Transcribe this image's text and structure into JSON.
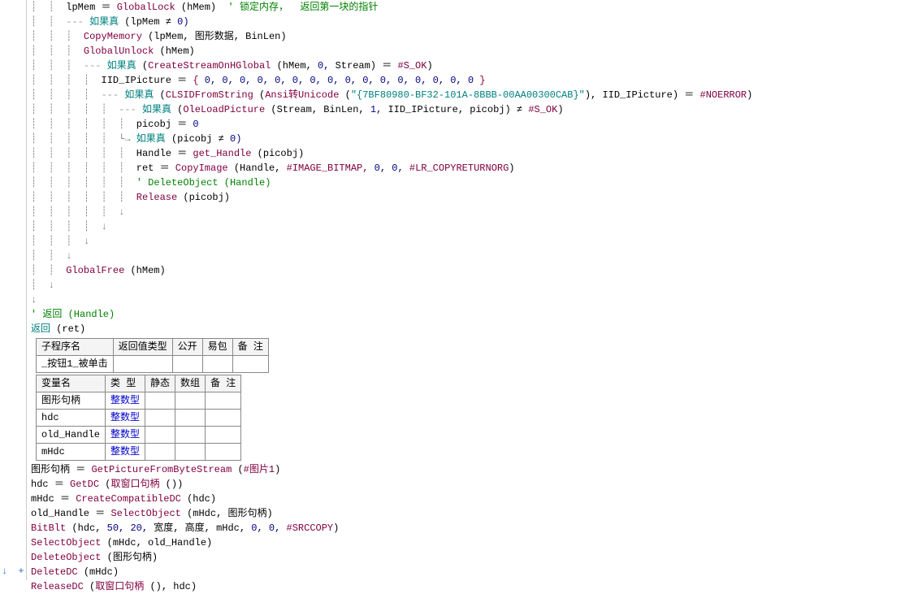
{
  "code": {
    "l1": {
      "a": "lpMem",
      "b": "＝",
      "c": "GlobalLock",
      "d": "(hMem)",
      "cmt": "' 锁定内存，  返回第一块的指针"
    },
    "l2": {
      "a": "如果真",
      "b": "(lpMem",
      "c": "≠",
      "d": "0)"
    },
    "l3": {
      "a": "CopyMemory",
      "b": "(lpMem,",
      "c": "图形数据,",
      "d": "BinLen)"
    },
    "l4": {
      "a": "GlobalUnlock",
      "b": "(hMem)"
    },
    "l5": {
      "a": "如果真",
      "b": "(",
      "c": "CreateStreamOnHGlobal",
      "d": "(hMem,",
      "e": "0,",
      "f": "Stream)",
      "g": "＝",
      "h": "#S_OK",
      "i": ")"
    },
    "l6": {
      "a": "IID_IPicture",
      "b": "＝",
      "c": "{",
      "d": "0, 0, 0, 0, 0, 0, 0, 0, 0, 0, 0, 0, 0, 0, 0, 0",
      "e": "}"
    },
    "l7": {
      "a": "如果真",
      "b": "(",
      "c": "CLSIDFromString",
      "d": "(",
      "e": "Ansi转Unicode",
      "f": "(",
      "g": "\"{7BF80980-BF32-101A-8BBB-00AA00300CAB}\"",
      "h": "),",
      "i": "IID_IPicture)",
      "j": "＝",
      "k": "#NOERROR",
      "l": ")"
    },
    "l8": {
      "a": "如果真",
      "b": "(",
      "c": "OleLoadPicture",
      "d": "(Stream,",
      "e": "BinLen,",
      "f": "1,",
      "g": "IID_IPicture,",
      "h": "picobj)",
      "i": "≠",
      "j": "#S_OK",
      "k": ")"
    },
    "l9": {
      "a": "picobj",
      "b": "＝",
      "c": "0"
    },
    "l10": {
      "a": "如果真",
      "b": "(picobj",
      "c": "≠",
      "d": "0)"
    },
    "l11": {
      "a": "Handle",
      "b": "＝",
      "c": "get_Handle",
      "d": "(picobj)"
    },
    "l12": {
      "a": "ret",
      "b": "＝",
      "c": "CopyImage",
      "d": "(Handle,",
      "e": "#IMAGE_BITMAP,",
      "f": "0,",
      "g": "0,",
      "h": "#LR_COPYRETURNORG",
      ")": ")"
    },
    "l13": {
      "cmt": "' DeleteObject (Handle)"
    },
    "l14": {
      "a": "Release",
      "b": "(picobj)"
    },
    "l15": {
      "a": "GlobalFree",
      "b": "(hMem)"
    },
    "l16": {
      "cmt": "' 返回 (Handle)"
    },
    "l17": {
      "a": "返回",
      "b": "(ret)"
    }
  },
  "table1": {
    "headers": [
      "子程序名",
      "返回值类型",
      "公开",
      "易包",
      "备 注"
    ],
    "row": [
      "_按钮1_被单击",
      "",
      "",
      "",
      ""
    ]
  },
  "table2": {
    "headers": [
      "变量名",
      "类 型",
      "静态",
      "数组",
      "备 注"
    ],
    "rows": [
      [
        "图形句柄",
        "整数型",
        "",
        "",
        ""
      ],
      [
        "hdc",
        "整数型",
        "",
        "",
        ""
      ],
      [
        "old_Handle",
        "整数型",
        "",
        "",
        ""
      ],
      [
        "mHdc",
        "整数型",
        "",
        "",
        ""
      ]
    ]
  },
  "code2": {
    "l1": {
      "a": "图形句柄",
      "b": "＝",
      "c": "GetPictureFromByteStream",
      "d": "(",
      "e": "#图片1",
      "f": ")"
    },
    "l2": {
      "a": "hdc",
      "b": "＝",
      "c": "GetDC",
      "d": "(",
      "e": "取窗口句柄",
      "f": "())"
    },
    "l3": {
      "a": "mHdc",
      "b": "＝",
      "c": "CreateCompatibleDC",
      "d": "(hdc)"
    },
    "l4": {
      "a": "old_Handle",
      "b": "＝",
      "c": "SelectObject",
      "d": "(mHdc,",
      "e": "图形句柄)"
    },
    "l5": {
      "a": "BitBlt",
      "b": "(hdc,",
      "c": "50,",
      "d": "20,",
      "e": "宽度,",
      "f": "高度,",
      "g": "mHdc,",
      "h": "0,",
      "i": "0,",
      "j": "#SRCCOPY",
      ")": ")"
    },
    "l6": {
      "a": "SelectObject",
      "b": "(mHdc,",
      "c": "old_Handle)"
    },
    "l7": {
      "a": "DeleteObject",
      "b": "(图形句柄)"
    },
    "l8": {
      "a": "DeleteDC",
      "b": "(mHdc)"
    },
    "l9": {
      "a": "ReleaseDC",
      "b": "(",
      "c": "取窗口句柄",
      "d": "(),",
      "e": "hdc)"
    }
  },
  "gutter": {
    "down": "↓",
    "plus": "+"
  }
}
